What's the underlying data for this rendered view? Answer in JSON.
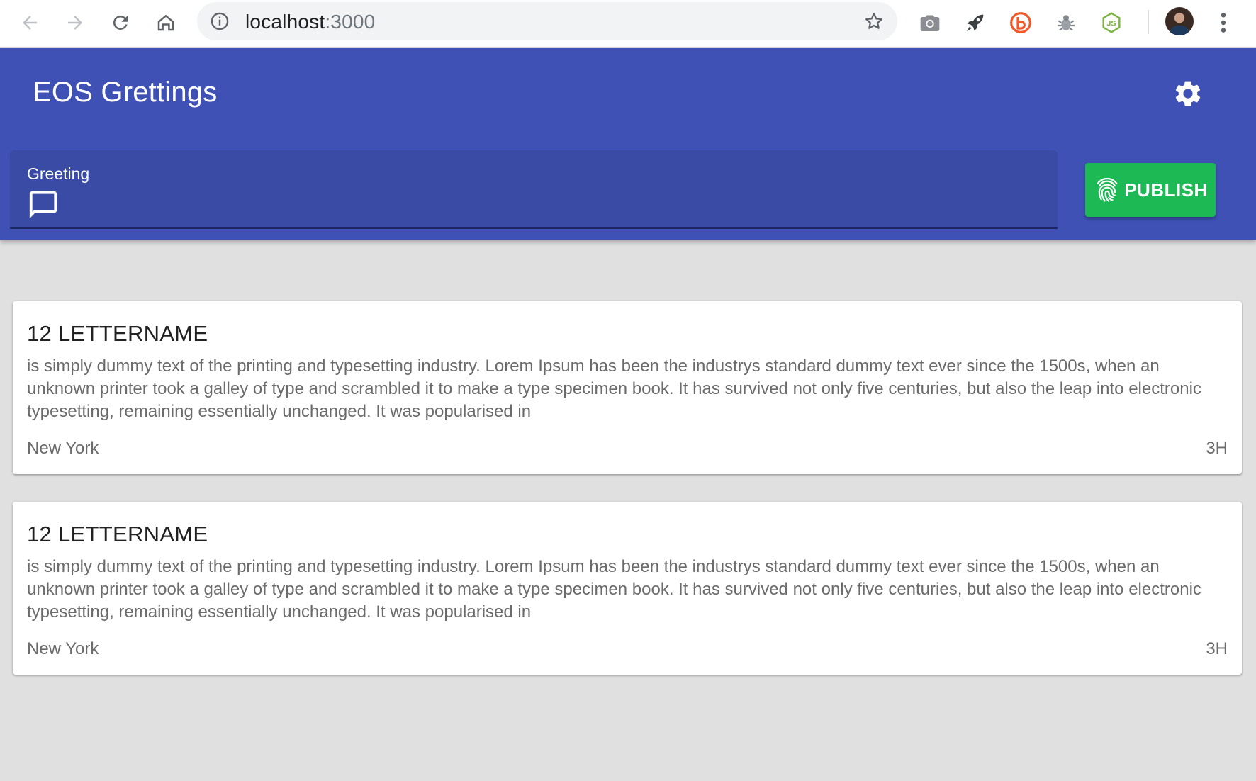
{
  "browser": {
    "url_host": "localhost",
    "url_port": ":3000",
    "back_icon": "arrow-left-icon",
    "forward_icon": "arrow-right-icon",
    "reload_icon": "reload-icon",
    "home_icon": "home-icon",
    "extensions": [
      "camera-icon",
      "rocket-icon",
      "b-badge-icon",
      "bug-icon",
      "nodejs-icon"
    ],
    "colors": {
      "bar_bg": "#ffffff",
      "omnibox_bg": "#f1f3f4"
    }
  },
  "app": {
    "title": "EOS Grettings",
    "settings_icon": "gear-icon",
    "greeting_field": {
      "label": "Greeting",
      "icon": "chat-bubble-icon",
      "value": ""
    },
    "publish_button": {
      "label": "PUBLISH",
      "icon": "fingerprint-icon"
    },
    "colors": {
      "appbar": "#3f51b5",
      "field_bg": "#394ba5",
      "publish": "#1db954",
      "page_bg": "#e0e0e0"
    }
  },
  "greetings": [
    {
      "title": "12 LETTERNAME",
      "body": "is simply dummy text of the printing and typesetting industry. Lorem Ipsum has been the industrys standard dummy text ever since the 1500s, when an unknown printer took a galley of type and scrambled it to make a type specimen book. It has survived not only five centuries, but also the leap into electronic typesetting, remaining essentially unchanged. It was popularised in",
      "location": "New York",
      "time": "3H"
    },
    {
      "title": "12 LETTERNAME",
      "body": "is simply dummy text of the printing and typesetting industry. Lorem Ipsum has been the industrys standard dummy text ever since the 1500s, when an unknown printer took a galley of type and scrambled it to make a type specimen book. It has survived not only five centuries, but also the leap into electronic typesetting, remaining essentially unchanged. It was popularised in",
      "location": "New York",
      "time": "3H"
    }
  ]
}
